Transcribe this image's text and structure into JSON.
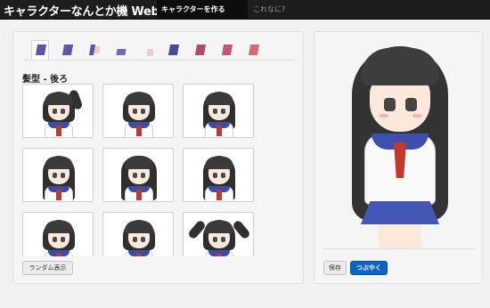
{
  "navbar": {
    "brand": "キャラクターなんとか機 Web版",
    "links": [
      {
        "label": "キャラクターを作る",
        "active": true
      },
      {
        "label": "これなに?",
        "active": false
      }
    ]
  },
  "editor": {
    "parts_tabs": [
      {
        "icon": "hair-back-part-icon",
        "active": true
      },
      {
        "icon": "hair-front-part-icon",
        "active": false
      },
      {
        "icon": "face-part-icon",
        "active": false
      },
      {
        "icon": "clothes-part-icon",
        "active": false
      },
      {
        "icon": "eyebrow-part-icon",
        "active": false
      },
      {
        "icon": "eye-part-icon",
        "active": false
      },
      {
        "icon": "eye-highlight-part-icon",
        "active": false
      },
      {
        "icon": "mouth-part-icon",
        "active": false
      },
      {
        "icon": "accessory-part-icon",
        "active": false
      }
    ],
    "section_title": "髪型 - 後ろ",
    "options": [
      {
        "style": "side-ponytail"
      },
      {
        "style": "short"
      },
      {
        "style": "medium"
      },
      {
        "style": "long-straight"
      },
      {
        "style": "long-tips"
      },
      {
        "style": "long"
      },
      {
        "style": "short-2"
      },
      {
        "style": "short-3"
      },
      {
        "style": "twintail"
      }
    ],
    "random_button": "ランダム表示"
  },
  "preview": {
    "save_button": "保存",
    "tweet_button": "つぶやく"
  },
  "colors": {
    "navbar_bg": "#1d1d1d",
    "hair": "#333333",
    "uniform_collar": "#3f4fb0",
    "tie": "#c0392b",
    "tweet_button": "#0a64c9"
  }
}
